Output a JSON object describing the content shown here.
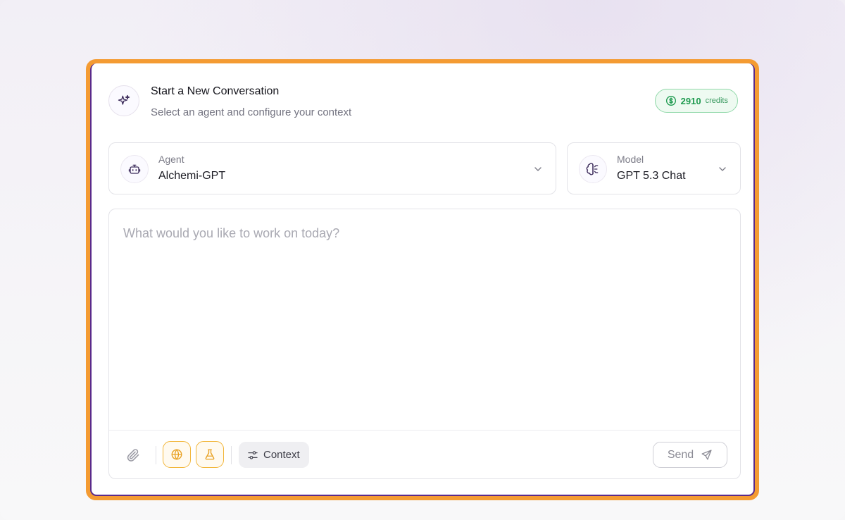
{
  "header": {
    "title": "Start a New Conversation",
    "subtitle": "Select an agent and configure your context",
    "icon": "sparkles-icon"
  },
  "credits": {
    "amount": "2910",
    "label": "credits",
    "color": "#1e9a4f"
  },
  "agent": {
    "label": "Agent",
    "value": "Alchemi-GPT",
    "icon": "bot-icon"
  },
  "model": {
    "label": "Model",
    "value": "GPT 5.3 Chat",
    "icon": "brain-icon"
  },
  "composer": {
    "placeholder": "What would you like to work on today?",
    "value": ""
  },
  "toolbar": {
    "context_label": "Context",
    "send_label": "Send",
    "accent_color": "#f2b63a"
  },
  "highlight_color": "#f49b32"
}
